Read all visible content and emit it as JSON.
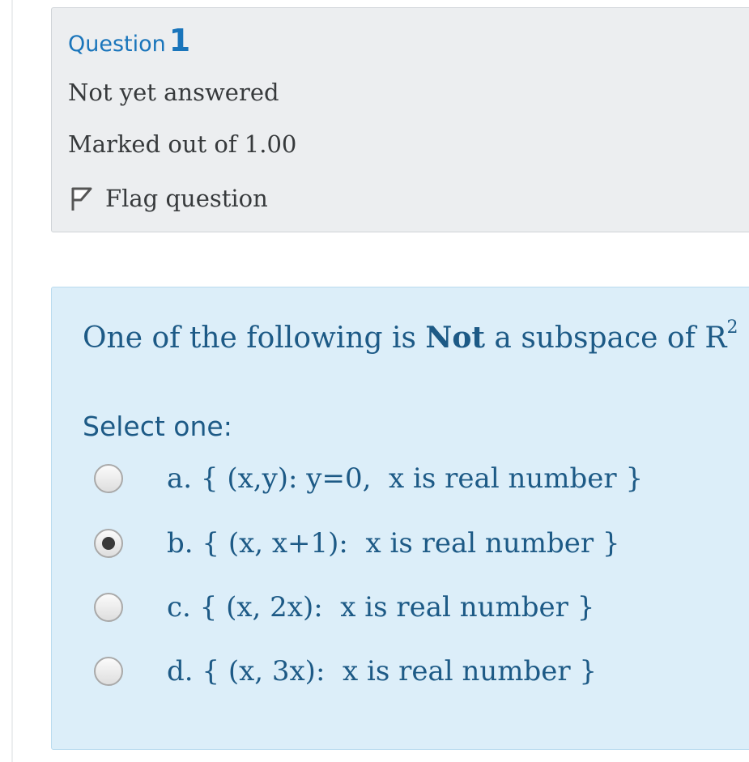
{
  "info": {
    "question_label": "Question",
    "question_number": "1",
    "state": "Not yet answered",
    "grade": "Marked out of 1.00",
    "flag_label": "Flag question"
  },
  "question": {
    "text_before": "One of the following is ",
    "text_bold": "Not",
    "text_after": " a subspace of R",
    "superscript": "2",
    "prompt": "Select one:",
    "options": [
      {
        "label": "a. { (x,y): y=0,  x is real number }",
        "selected": false
      },
      {
        "label": "b. { (x, x+1):  x is real number }",
        "selected": true
      },
      {
        "label": "c. { (x, 2x):  x is real number }",
        "selected": false
      },
      {
        "label": "d. { (x, 3x):  x is real number }",
        "selected": false
      }
    ]
  },
  "colors": {
    "accent_blue": "#1a75bb",
    "question_text": "#1d5a86",
    "content_bg": "#dceef9",
    "info_bg": "#eceef0"
  },
  "icons": {
    "flag": "flag-outline-icon",
    "radio_selected": "radio-checked-icon",
    "radio_unselected": "radio-unchecked-icon"
  }
}
